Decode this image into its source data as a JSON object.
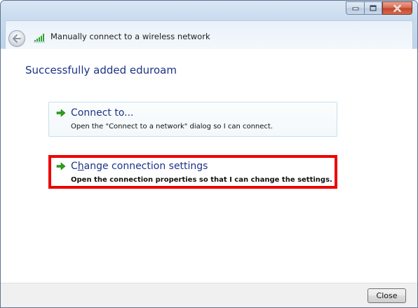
{
  "window": {
    "title": "Manually connect to a wireless network"
  },
  "main": {
    "heading": "Successfully added eduroam",
    "options": [
      {
        "title": "Connect to...",
        "description": "Open the \"Connect to a network\" dialog so I can connect.",
        "icon": "green-arrow-icon"
      },
      {
        "title_prefix": "C",
        "title_accel": "h",
        "title_rest": "ange connection settings",
        "description": "Open the connection properties so that I can change the settings.",
        "icon": "green-arrow-icon",
        "highlighted": true,
        "highlight_color": "#ee0000"
      }
    ]
  },
  "footer": {
    "close_label": "Close"
  },
  "colors": {
    "heading": "#1e3287",
    "arrow": "#2aa01a",
    "highlight": "#ee0000"
  }
}
